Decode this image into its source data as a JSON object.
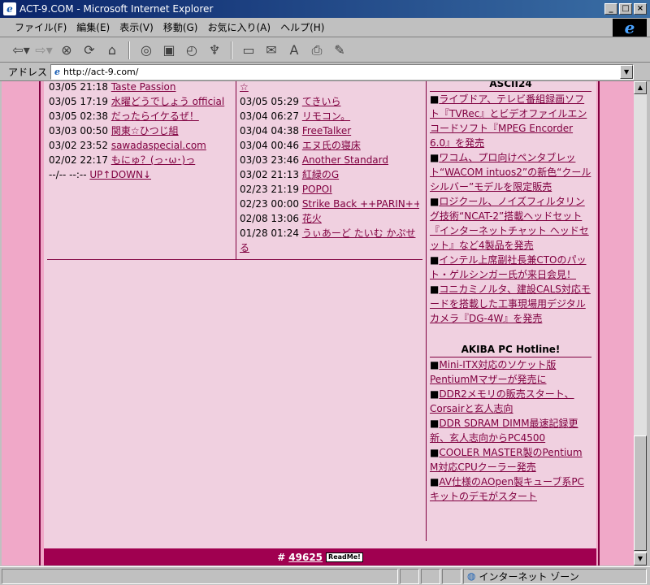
{
  "window": {
    "title": "ACT-9.COM - Microsoft Internet Explorer",
    "app_icon": "e",
    "buttons": [
      "_",
      "□",
      "×"
    ]
  },
  "menu": [
    "ファイル(F)",
    "編集(E)",
    "表示(V)",
    "移動(G)",
    "お気に入り(A)",
    "ヘルプ(H)"
  ],
  "ie_logo": "e",
  "toolbar": {
    "back": "⇦▾",
    "forward": "⇨▾",
    "stop": "⊗",
    "refresh": "⟳",
    "home": "⌂",
    "search": "◎",
    "favorites": "▣",
    "history": "◴",
    "channels": "♆",
    "fullscreen": "▭",
    "mail": "✉",
    "font": "A",
    "print": "⎙",
    "edit": "✎"
  },
  "address": {
    "label": "アドレス",
    "value": "http://act-9.com/",
    "page_icon": "e",
    "dropdown": "▼"
  },
  "left_list": [
    {
      "time": "03/05 21:18",
      "title": "Taste Passion"
    },
    {
      "time": "03/05 17:19",
      "title": "水曜どうでしょう official"
    },
    {
      "time": "03/05 02:38",
      "title": "だったらイケるぜ！"
    },
    {
      "time": "03/03 00:50",
      "title": "関東☆ひつじ組"
    },
    {
      "time": "03/02 23:52",
      "title": "sawadaspecial.com"
    },
    {
      "time": "02/02 22:17",
      "title": "もにゅ？(っ･ω･)っ"
    },
    {
      "time": "--/-- --:--",
      "title": "UP↑DOWN↓"
    }
  ],
  "mid_list_top": "☆",
  "mid_list": [
    {
      "time": "03/05 05:29",
      "title": "てきいら"
    },
    {
      "time": "03/04 06:27",
      "title": "リモコン。"
    },
    {
      "time": "03/04 04:38",
      "title": "FreeTalker"
    },
    {
      "time": "03/04 00:46",
      "title": "エヌ氏の寝床"
    },
    {
      "time": "03/03 23:46",
      "title": "Another Standard"
    },
    {
      "time": "03/02 21:13",
      "title": "紅緑のG"
    },
    {
      "time": "02/23 21:19",
      "title": "POPOI"
    },
    {
      "time": "02/23 00:00",
      "title": "Strike Back ++PARIN++"
    },
    {
      "time": "02/08 13:06",
      "title": "花火"
    },
    {
      "time": "01/28 01:24",
      "title": "うぃあーど たいむ かぷせ"
    },
    {
      "time": "",
      "title": "る"
    }
  ],
  "ascii": {
    "title": "ASCII24",
    "bullet": "■",
    "items": [
      "ライブドア、テレビ番組録画ソフト『TVRec』とビデオファイルエンコードソフト『MPEG Encorder 6.0』を発売",
      "ワコム、プロ向けペンタブレット“WACOM intuos2”の新色“クールシルバー”モデルを限定販売",
      "ロジクール、ノイズフィルタリング技術“NCAT-2”搭載ヘッドセット『インターネットチャット ヘッドセット』など4製品を発売",
      "インテル上席副社長兼CTOのパット・ゲルシンガー氏が来日会見！",
      "コニカミノルタ、建設CALS対応モードを搭載した工事現場用デジタルカメラ『DG-4W』を発売"
    ]
  },
  "akiba": {
    "title": "AKIBA PC Hotline!",
    "bullet": "■",
    "items": [
      "Mini-ITX対応のソケット版PentiumMマザーが発売に",
      "DDR2メモリの販売スタート、Corsairと玄人志向",
      "DDR SDRAM DIMM最速記録更新、玄人志向からPC4500",
      "COOLER MASTER製のPentium M対応CPUクーラー発売",
      "AV仕様のAOpen製キューブ系PCキットのデモがスタート"
    ]
  },
  "footer": {
    "hash": "#",
    "count": "49625",
    "badge": "ReadMe!"
  },
  "scrollbar": {
    "up": "▲",
    "down": "▼"
  },
  "status": {
    "zone_icon": "◍",
    "zone": "インターネット ゾーン"
  }
}
